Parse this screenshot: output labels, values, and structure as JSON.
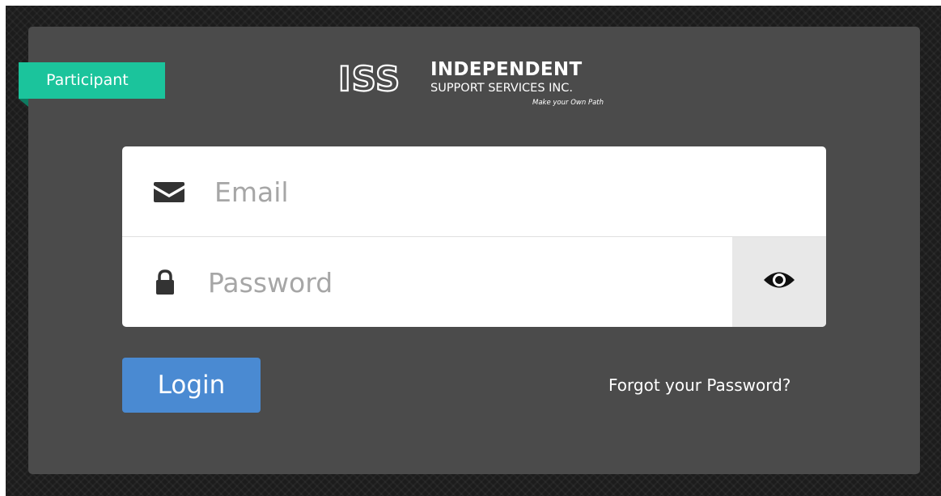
{
  "badge": {
    "label": "Participant"
  },
  "brand": {
    "mark": "ISS",
    "name": "INDEPENDENT",
    "subtitle": "SUPPORT SERVICES INC.",
    "tagline": "Make your Own Path"
  },
  "form": {
    "email_placeholder": "Email",
    "email_value": "",
    "password_placeholder": "Password",
    "password_value": "",
    "email_icon": "envelope-icon",
    "password_icon": "lock-icon",
    "reveal_icon": "eye-icon"
  },
  "actions": {
    "login_label": "Login",
    "forgot_label": "Forgot your Password?"
  },
  "colors": {
    "accent": "#1bc49c",
    "button": "#4a8ad2",
    "panel": "#4b4b4b"
  }
}
